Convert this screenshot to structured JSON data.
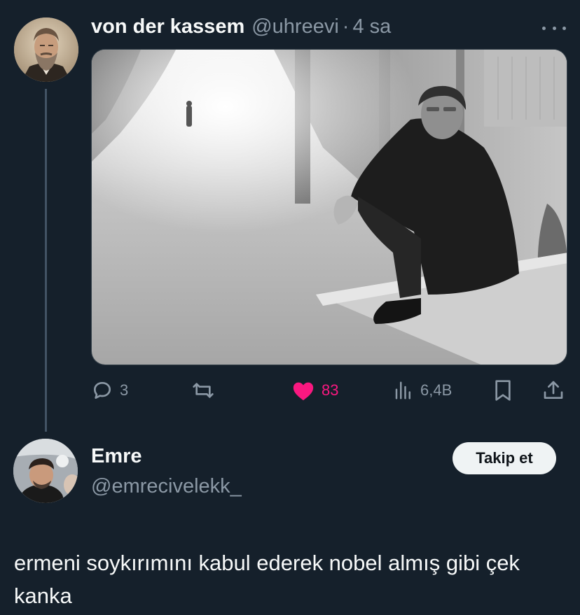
{
  "tweet": {
    "display_name": "von der kassem",
    "handle": "@uhreevi",
    "separator": "·",
    "time": "4 sa",
    "stats": {
      "replies": "3",
      "likes": "83",
      "views": "6,4B"
    },
    "icons": [
      "more-icon",
      "reply-icon",
      "retweet-icon",
      "heart-icon",
      "views-icon",
      "bookmark-icon",
      "share-icon"
    ],
    "like_color": "#f91880"
  },
  "reply": {
    "display_name": "Emre",
    "handle": "@emrecivelekk_",
    "follow_label": "Takip et",
    "text": "ermeni soykırımını kabul ederek nobel almış gibi çek kanka"
  },
  "colors": {
    "background": "#15202b",
    "muted": "#8b98a5"
  }
}
